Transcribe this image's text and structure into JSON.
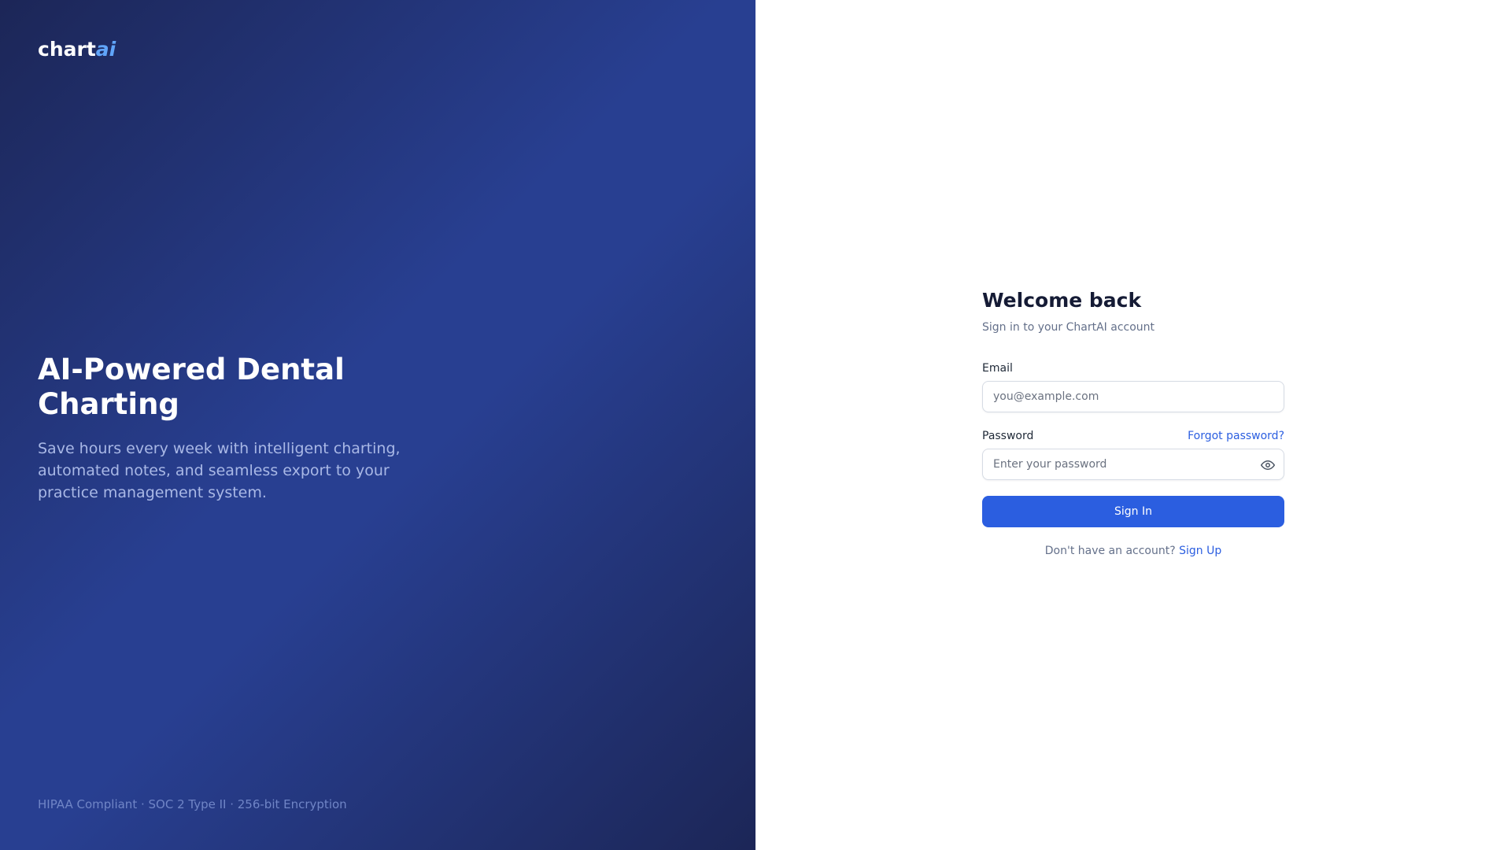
{
  "brand": {
    "logo_text": "chart",
    "logo_accent": "ai",
    "accent_color": "#60a5fa",
    "primary_color": "#2b5ee0"
  },
  "hero": {
    "title": "AI-Powered Dental Charting",
    "description": "Save hours every week with intelligent charting, automated notes, and seamless export to your practice management system."
  },
  "footer": {
    "compliance": "HIPAA Compliant · SOC 2 Type II · 256-bit Encryption"
  },
  "login": {
    "heading": "Welcome back",
    "subheading": "Sign in to your ChartAI account",
    "email_label": "Email",
    "email_placeholder": "you@example.com",
    "email_value": "",
    "password_label": "Password",
    "password_placeholder": "Enter your password",
    "password_value": "",
    "password_toggle_icon": "eye-icon",
    "forgot_link": "Forgot password?",
    "submit_label": "Sign In",
    "signup_prompt": "Don't have an account?",
    "signup_link": "Sign Up"
  }
}
